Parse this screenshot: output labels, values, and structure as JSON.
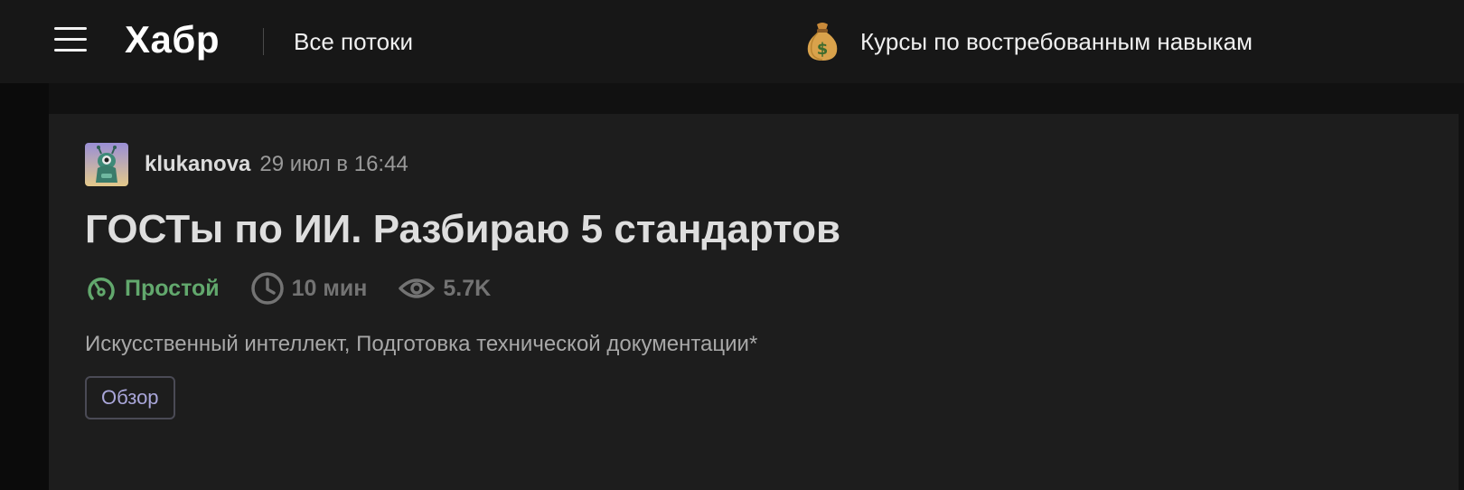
{
  "header": {
    "logo": "Хабр",
    "nav_link": "Все потоки",
    "promo_text": "Курсы по востребованным навыкам",
    "promo_icon": "money-bag-icon"
  },
  "article": {
    "author": "klukanova",
    "date": "29 июл в 16:44",
    "title": "ГОСТы по ИИ. Разбираю 5 стандартов",
    "stats": {
      "complexity": "Простой",
      "reading_time": "10 мин",
      "views": "5.7K"
    },
    "hubs": {
      "hub1": "Искусственный интеллект",
      "separator": ", ",
      "hub2": "Подготовка технической документации*"
    },
    "tag": "Обзор"
  },
  "colors": {
    "complexity_easy": "#62a86d",
    "tag_text": "#a9a6d9",
    "card_background": "#1d1d1d",
    "header_background": "#171717"
  }
}
